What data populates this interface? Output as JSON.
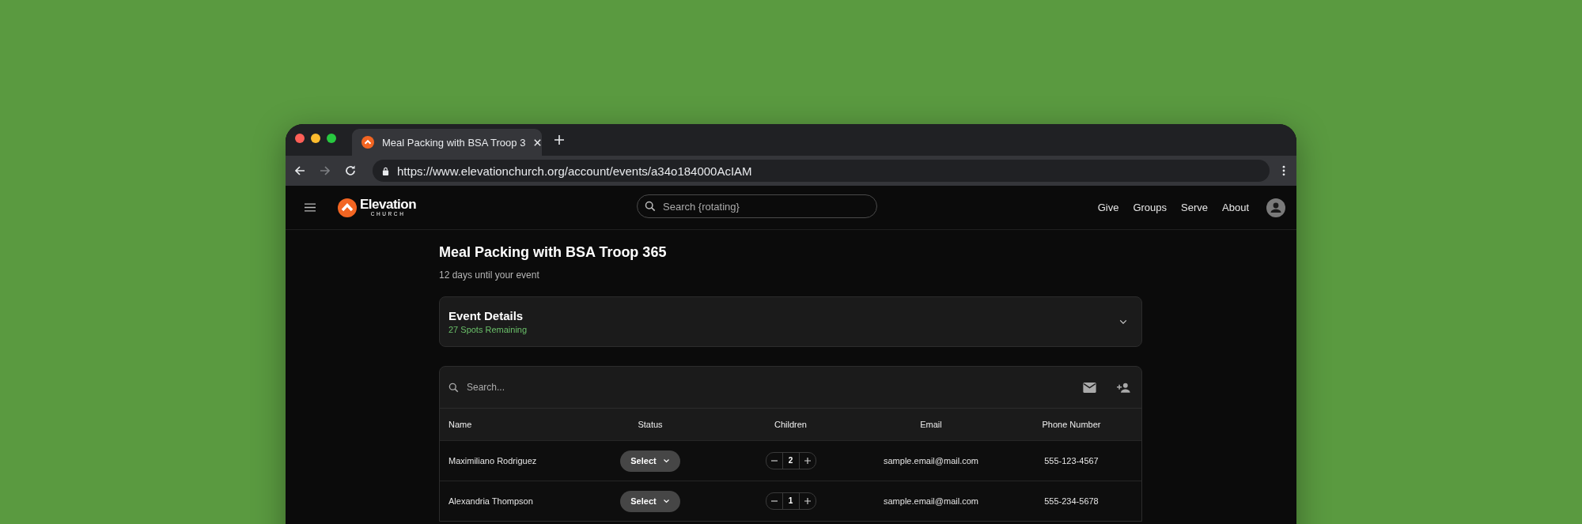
{
  "browser": {
    "tab_title": "Meal Packing with BSA Troop 3",
    "url": "https://www.elevationchurch.org/account/events/a34o184000AcIAM"
  },
  "header": {
    "logo_name": "Elevation",
    "logo_sub": "CHURCH",
    "search": {
      "placeholder": "Search {rotating}"
    },
    "nav": [
      "Give",
      "Groups",
      "Serve",
      "About"
    ]
  },
  "event": {
    "title": "Meal Packing with BSA Troop 365",
    "subtitle": "12 days until your event"
  },
  "details": {
    "title": "Event Details",
    "spots": "27 Spots Remaining",
    "expanded": false
  },
  "table": {
    "search": {
      "placeholder": "Search..."
    },
    "columns": [
      "Name",
      "Status",
      "Children",
      "Email",
      "Phone Number"
    ],
    "rows": [
      {
        "name": "Maximiliano Rodriguez",
        "status": "Select",
        "children": "2",
        "email": "sample.email@mail.com",
        "phone": "555-123-4567"
      },
      {
        "name": "Alexandria Thompson",
        "status": "Select",
        "children": "1",
        "email": "sample.email@mail.com",
        "phone": "555-234-5678"
      }
    ]
  }
}
